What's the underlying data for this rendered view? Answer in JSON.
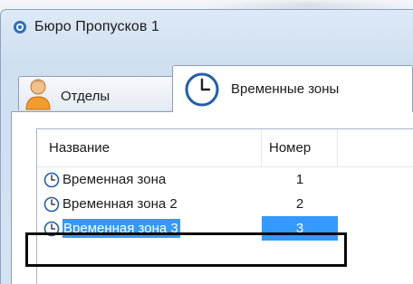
{
  "window": {
    "title": "Бюро Пропусков 1"
  },
  "tabs": [
    {
      "label": "Отделы",
      "icon": "person-icon",
      "active": false
    },
    {
      "label": "Временные зоны",
      "icon": "clock-icon",
      "active": true
    }
  ],
  "list": {
    "columns": [
      "Название",
      "Номер"
    ],
    "rows": [
      {
        "name": "Временная зона",
        "number": "1",
        "icon": "clock-icon",
        "selected": false
      },
      {
        "name": "Временная зона 2",
        "number": "2",
        "icon": "clock-icon",
        "selected": false
      },
      {
        "name": "Временная зона 3",
        "number": "3",
        "icon": "clock-icon",
        "selected": true
      }
    ]
  },
  "colors": {
    "selection": "#3399ff",
    "highlight_border": "#0a0a0a",
    "window_bg": "#d4e3f2"
  }
}
